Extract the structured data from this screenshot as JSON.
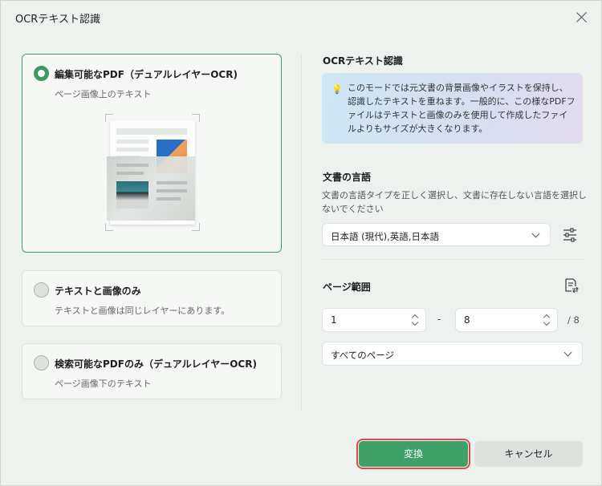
{
  "window": {
    "title": "OCRテキスト認識"
  },
  "options": [
    {
      "title": "編集可能なPDF（デュアルレイヤーOCR)",
      "subtitle": "ページ画像上のテキスト",
      "selected": true
    },
    {
      "title": "テキストと画像のみ",
      "subtitle": "テキストと画像は同じレイヤーにあります。",
      "selected": false
    },
    {
      "title": "検索可能なPDFのみ（デュアルレイヤーOCR)",
      "subtitle": "ページ画像下のテキスト",
      "selected": false
    }
  ],
  "info": {
    "heading": "OCRテキスト認識",
    "text": "このモードでは元文書の背景画像やイラストを保持し、認識したテキストを重ねます。一般的に、この様なPDFファイルはテキストと画像のみを使用して作成したファイルよりもサイズが大きくなります。"
  },
  "language": {
    "heading": "文書の言語",
    "description": "文書の言語タイプを正しく選択し、文書に存在しない言語を選択しないでください",
    "selected": "日本語 (現代),英語,日本語"
  },
  "page_range": {
    "heading": "ページ範囲",
    "from": "1",
    "separator": "-",
    "to": "8",
    "total": "/ 8",
    "scope": "すべてのページ"
  },
  "buttons": {
    "convert": "変換",
    "cancel": "キャンセル"
  },
  "colors": {
    "accent": "#3f9f69",
    "highlight_outline": "#e04848"
  }
}
